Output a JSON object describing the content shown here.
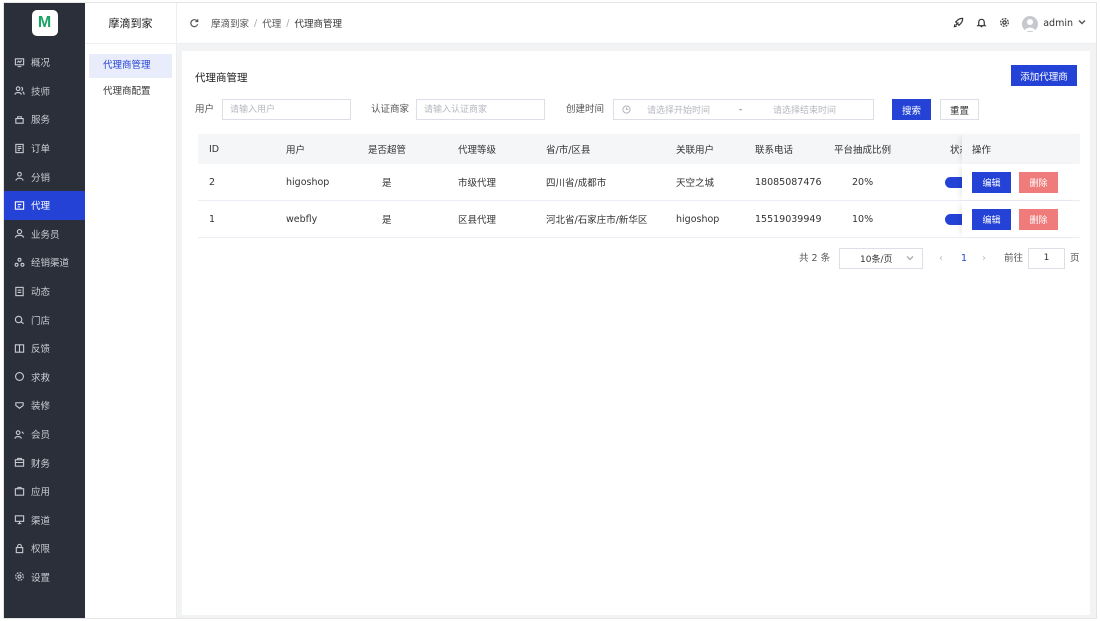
{
  "app": {
    "logo_letter": "M",
    "brand": "摩滴到家"
  },
  "menu": [
    {
      "label": "概况",
      "icon": "monitor-icon"
    },
    {
      "label": "技师",
      "icon": "users-icon"
    },
    {
      "label": "服务",
      "icon": "service-icon"
    },
    {
      "label": "订单",
      "icon": "order-icon"
    },
    {
      "label": "分销",
      "icon": "share-icon"
    },
    {
      "label": "代理",
      "icon": "agent-icon",
      "active": true
    },
    {
      "label": "业务员",
      "icon": "user-icon"
    },
    {
      "label": "经销渠道",
      "icon": "channel-icon"
    },
    {
      "label": "动态",
      "icon": "news-icon"
    },
    {
      "label": "门店",
      "icon": "store-icon"
    },
    {
      "label": "反馈",
      "icon": "feedback-icon"
    },
    {
      "label": "求救",
      "icon": "help-icon"
    },
    {
      "label": "装修",
      "icon": "decorate-icon"
    },
    {
      "label": "会员",
      "icon": "member-icon"
    },
    {
      "label": "财务",
      "icon": "finance-icon"
    },
    {
      "label": "应用",
      "icon": "apps-icon"
    },
    {
      "label": "渠道",
      "icon": "screen-icon"
    },
    {
      "label": "权限",
      "icon": "lock-icon"
    },
    {
      "label": "设置",
      "icon": "gear-icon"
    }
  ],
  "submenu": [
    {
      "label": "代理商管理",
      "active": true
    },
    {
      "label": "代理商配置"
    }
  ],
  "breadcrumb": [
    "摩滴到家",
    "代理",
    "代理商管理"
  ],
  "header": {
    "username": "admin"
  },
  "page": {
    "title": "代理商管理",
    "add_button": "添加代理商"
  },
  "filters": {
    "user_label": "用户",
    "user_placeholder": "请输入用户",
    "merchant_label": "认证商家",
    "merchant_placeholder": "请输入认证商家",
    "time_label": "创建时间",
    "start_placeholder": "请选择开始时间",
    "range_sep": "-",
    "end_placeholder": "请选择结束时间",
    "search_button": "搜索",
    "reset_button": "重置"
  },
  "table": {
    "columns": [
      "ID",
      "用户",
      "是否超管",
      "代理等级",
      "省/市/区县",
      "关联用户",
      "联系电话",
      "平台抽成比例",
      "状态",
      "操作"
    ],
    "rows": [
      {
        "id": "2",
        "user": "higoshop",
        "super": "是",
        "level": "市级代理",
        "region": "四川省/成都市",
        "linked": "天空之城",
        "phone": "18085087476",
        "ratio": "20%",
        "status": true
      },
      {
        "id": "1",
        "user": "webfly",
        "super": "是",
        "level": "区县代理",
        "region": "河北省/石家庄市/新华区",
        "linked": "higoshop",
        "phone": "15519039949",
        "ratio": "10%",
        "status": true
      }
    ],
    "edit_label": "编辑",
    "delete_label": "删除"
  },
  "pagination": {
    "total_text": "共 2 条",
    "page_size": "10条/页",
    "current_page": "1",
    "goto_label": "前往",
    "goto_value": "1",
    "page_suffix": "页"
  },
  "colors": {
    "primary": "#2443d6",
    "danger": "#f07b7b",
    "sidebar": "#2b2f3a"
  }
}
